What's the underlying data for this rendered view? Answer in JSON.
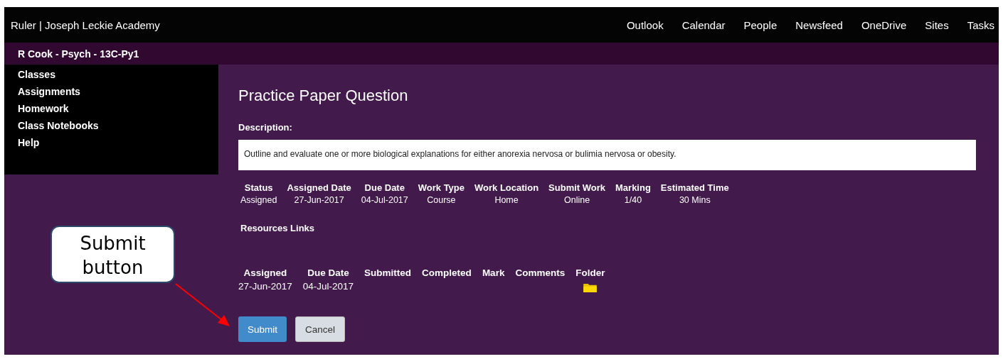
{
  "top_bar": {
    "title": "Ruler | Joseph Leckie Academy",
    "links": [
      "Outlook",
      "Calendar",
      "People",
      "Newsfeed",
      "OneDrive",
      "Sites",
      "Tasks"
    ]
  },
  "sub_header": {
    "title": "R Cook - Psych - 13C-Py1"
  },
  "sidebar": {
    "items": [
      "Classes",
      "Assignments",
      "Homework",
      "Class Notebooks",
      "Help"
    ]
  },
  "assignment": {
    "title": "Practice Paper Question",
    "description_label": "Description:",
    "description": "Outline and evaluate one or more biological explanations for either anorexia nervosa or bulimia nervosa or obesity.",
    "details": [
      {
        "label": "Status",
        "value": "Assigned"
      },
      {
        "label": "Assigned Date",
        "value": "27-Jun-2017"
      },
      {
        "label": "Due Date",
        "value": "04-Jul-2017"
      },
      {
        "label": "Work Type",
        "value": "Course"
      },
      {
        "label": "Work Location",
        "value": "Home"
      },
      {
        "label": "Submit Work",
        "value": "Online"
      },
      {
        "label": "Marking",
        "value": "1/40"
      },
      {
        "label": "Estimated Time",
        "value": "30 Mins"
      }
    ],
    "resources_label": "Resources Links"
  },
  "submission_table": {
    "columns": [
      {
        "label": "Assigned",
        "kind": "text"
      },
      {
        "label": "Due Date",
        "kind": "text"
      },
      {
        "label": "Submitted",
        "kind": "text"
      },
      {
        "label": "Completed",
        "kind": "text"
      },
      {
        "label": "Mark",
        "kind": "text"
      },
      {
        "label": "Comments",
        "kind": "text"
      },
      {
        "label": "Folder",
        "kind": "folder"
      }
    ],
    "rows": [
      {
        "cells": [
          "27-Jun-2017",
          "04-Jul-2017"
        ]
      }
    ]
  },
  "buttons": [
    {
      "label": "Submit",
      "kind": "primary"
    },
    {
      "label": "Cancel",
      "kind": "secondary"
    }
  ],
  "callout": {
    "text": "Submit button"
  }
}
